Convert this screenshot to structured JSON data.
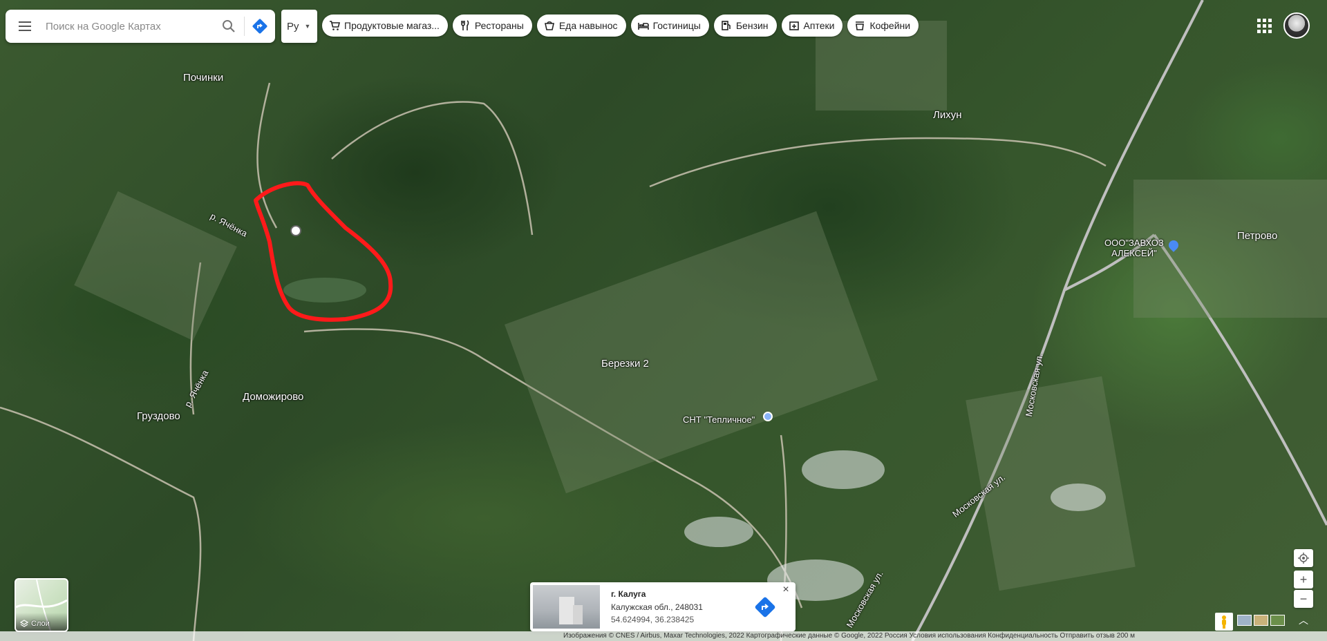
{
  "search": {
    "placeholder": "Поиск на Google Картах"
  },
  "language": {
    "label": "Ру"
  },
  "chips": [
    {
      "label": "Продуктовые магаз...",
      "icon": "cart-icon"
    },
    {
      "label": "Рестораны",
      "icon": "fork-knife-icon"
    },
    {
      "label": "Еда навынос",
      "icon": "takeout-icon"
    },
    {
      "label": "Гостиницы",
      "icon": "bed-icon"
    },
    {
      "label": "Бензин",
      "icon": "fuel-icon"
    },
    {
      "label": "Аптеки",
      "icon": "pharmacy-icon"
    },
    {
      "label": "Кофейни",
      "icon": "coffee-icon"
    }
  ],
  "places": {
    "pochinki": "Починки",
    "likhun": "Лихун",
    "petrovo": "Петрово",
    "zavkhoz_line1": "ООО\"ЗАВХОЗ",
    "zavkhoz_line2": "АЛЕКСЕЙ\"",
    "river1": "р. Ячёнка",
    "river2": "р. Ячёнка",
    "berezki": "Березки 2",
    "domozhirovo": "Доможирово",
    "gruzdovo": "Груздово",
    "snt": "СНТ \"Тепличное\"",
    "moskovskaya1": "Московская ул.",
    "moskovskaya2": "Московская ул.",
    "moskovskaya3": "Московская ул."
  },
  "info_card": {
    "title": "г. Калуга",
    "address": "Калужская обл., 248031",
    "coords": "54.624994, 36.238425"
  },
  "layers": {
    "label": "Слои"
  },
  "footer": {
    "text": "Изображения © CNES / Airbus, Maxar Technologies, 2022 Картографические данные © Google, 2022    Россия    Условия использования    Конфиденциальность    Отправить отзыв    200 м"
  },
  "colors": {
    "accent": "#1a73e8",
    "marker": "#ff0000"
  }
}
